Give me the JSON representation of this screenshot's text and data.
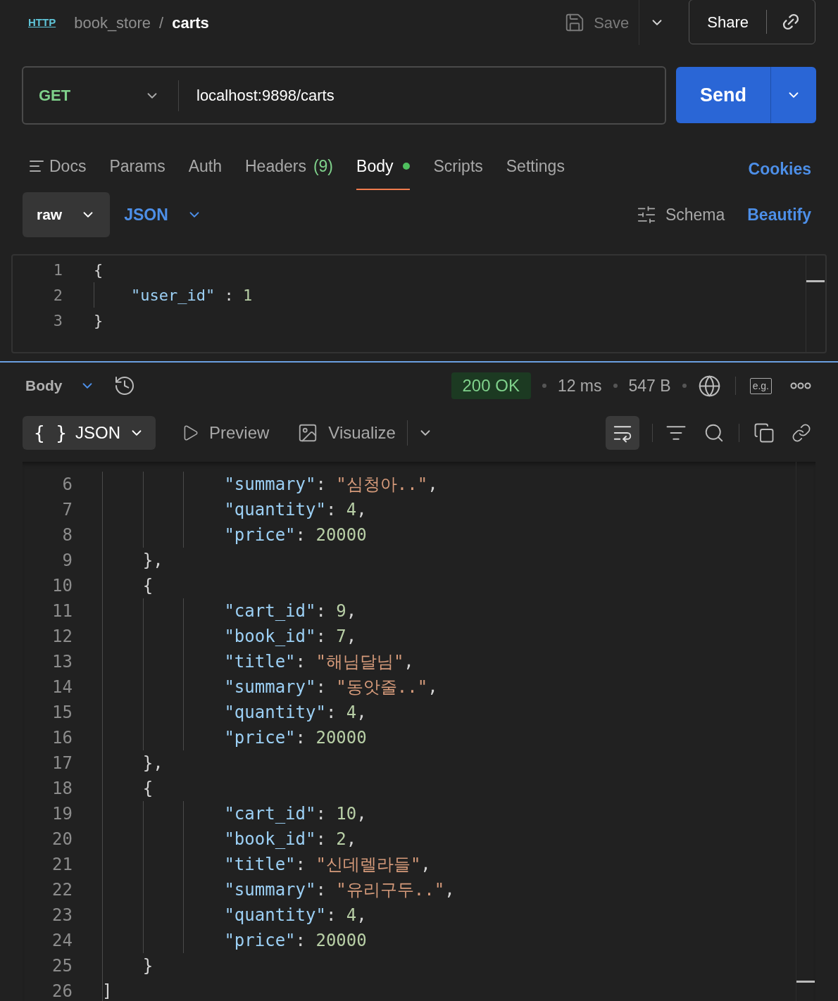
{
  "breadcrumb": {
    "icon_text": "HTTP",
    "collection": "book_store",
    "separator": "/",
    "request": "carts"
  },
  "toolbar": {
    "save": "Save",
    "share": "Share"
  },
  "request": {
    "method": "GET",
    "url": "localhost:9898/carts",
    "send": "Send"
  },
  "tabs": [
    {
      "kind": "docs",
      "label": "Docs",
      "selected": false,
      "has_content": false
    },
    {
      "kind": "plain",
      "label": "Params",
      "selected": false,
      "has_content": false
    },
    {
      "kind": "plain",
      "label": "Auth",
      "selected": false,
      "has_content": false
    },
    {
      "kind": "plain",
      "label": "Headers",
      "count": "(9)",
      "selected": false,
      "has_content": false
    },
    {
      "kind": "plain",
      "label": "Body",
      "selected": true,
      "has_content": true
    },
    {
      "kind": "plain",
      "label": "Scripts",
      "selected": false,
      "has_content": false
    },
    {
      "kind": "plain",
      "label": "Settings",
      "selected": false,
      "has_content": false
    }
  ],
  "cookies": "Cookies",
  "body_options": {
    "mode": "raw",
    "language": "JSON",
    "schema": "Schema",
    "beautify": "Beautify"
  },
  "request_body": [
    {
      "n": "1",
      "tokens": [
        {
          "kind": "punct",
          "text": "{"
        }
      ]
    },
    {
      "n": "2",
      "tokens": [
        {
          "kind": "key",
          "text": "    \"user_id\""
        },
        {
          "kind": "punct",
          "text": " : "
        },
        {
          "kind": "number",
          "text": "1"
        }
      ]
    },
    {
      "n": "3",
      "tokens": [
        {
          "kind": "punct",
          "text": "}"
        }
      ]
    }
  ],
  "response": {
    "view": "Body",
    "status": "200 OK",
    "time": "12 ms",
    "size": "547 B",
    "examples": "e.g.",
    "format_glyph": "{ }",
    "format": "JSON",
    "preview": "Preview",
    "visualize": "Visualize",
    "wrap_on": true,
    "lines": [
      {
        "n": "6",
        "tokens": [
          {
            "kind": "key",
            "text": "            \"summary\""
          },
          {
            "kind": "punct",
            "text": ": "
          },
          {
            "kind": "string",
            "text": "\"심청아..\""
          },
          {
            "kind": "punct",
            "text": ","
          }
        ]
      },
      {
        "n": "7",
        "tokens": [
          {
            "kind": "key",
            "text": "            \"quantity\""
          },
          {
            "kind": "punct",
            "text": ": "
          },
          {
            "kind": "number",
            "text": "4"
          },
          {
            "kind": "punct",
            "text": ","
          }
        ]
      },
      {
        "n": "8",
        "tokens": [
          {
            "kind": "key",
            "text": "            \"price\""
          },
          {
            "kind": "punct",
            "text": ": "
          },
          {
            "kind": "number",
            "text": "20000"
          }
        ]
      },
      {
        "n": "9",
        "tokens": [
          {
            "kind": "punct",
            "text": "    },"
          }
        ]
      },
      {
        "n": "10",
        "tokens": [
          {
            "kind": "punct",
            "text": "    {"
          }
        ]
      },
      {
        "n": "11",
        "tokens": [
          {
            "kind": "key",
            "text": "            \"cart_id\""
          },
          {
            "kind": "punct",
            "text": ": "
          },
          {
            "kind": "number",
            "text": "9"
          },
          {
            "kind": "punct",
            "text": ","
          }
        ]
      },
      {
        "n": "12",
        "tokens": [
          {
            "kind": "key",
            "text": "            \"book_id\""
          },
          {
            "kind": "punct",
            "text": ": "
          },
          {
            "kind": "number",
            "text": "7"
          },
          {
            "kind": "punct",
            "text": ","
          }
        ]
      },
      {
        "n": "13",
        "tokens": [
          {
            "kind": "key",
            "text": "            \"title\""
          },
          {
            "kind": "punct",
            "text": ": "
          },
          {
            "kind": "string",
            "text": "\"해님달님\""
          },
          {
            "kind": "punct",
            "text": ","
          }
        ]
      },
      {
        "n": "14",
        "tokens": [
          {
            "kind": "key",
            "text": "            \"summary\""
          },
          {
            "kind": "punct",
            "text": ": "
          },
          {
            "kind": "string",
            "text": "\"동앗줄..\""
          },
          {
            "kind": "punct",
            "text": ","
          }
        ]
      },
      {
        "n": "15",
        "tokens": [
          {
            "kind": "key",
            "text": "            \"quantity\""
          },
          {
            "kind": "punct",
            "text": ": "
          },
          {
            "kind": "number",
            "text": "4"
          },
          {
            "kind": "punct",
            "text": ","
          }
        ]
      },
      {
        "n": "16",
        "tokens": [
          {
            "kind": "key",
            "text": "            \"price\""
          },
          {
            "kind": "punct",
            "text": ": "
          },
          {
            "kind": "number",
            "text": "20000"
          }
        ]
      },
      {
        "n": "17",
        "tokens": [
          {
            "kind": "punct",
            "text": "    },"
          }
        ]
      },
      {
        "n": "18",
        "tokens": [
          {
            "kind": "punct",
            "text": "    {"
          }
        ]
      },
      {
        "n": "19",
        "tokens": [
          {
            "kind": "key",
            "text": "            \"cart_id\""
          },
          {
            "kind": "punct",
            "text": ": "
          },
          {
            "kind": "number",
            "text": "10"
          },
          {
            "kind": "punct",
            "text": ","
          }
        ]
      },
      {
        "n": "20",
        "tokens": [
          {
            "kind": "key",
            "text": "            \"book_id\""
          },
          {
            "kind": "punct",
            "text": ": "
          },
          {
            "kind": "number",
            "text": "2"
          },
          {
            "kind": "punct",
            "text": ","
          }
        ]
      },
      {
        "n": "21",
        "tokens": [
          {
            "kind": "key",
            "text": "            \"title\""
          },
          {
            "kind": "punct",
            "text": ": "
          },
          {
            "kind": "string",
            "text": "\"신데렐라들\""
          },
          {
            "kind": "punct",
            "text": ","
          }
        ]
      },
      {
        "n": "22",
        "tokens": [
          {
            "kind": "key",
            "text": "            \"summary\""
          },
          {
            "kind": "punct",
            "text": ": "
          },
          {
            "kind": "string",
            "text": "\"유리구두..\""
          },
          {
            "kind": "punct",
            "text": ","
          }
        ]
      },
      {
        "n": "23",
        "tokens": [
          {
            "kind": "key",
            "text": "            \"quantity\""
          },
          {
            "kind": "punct",
            "text": ": "
          },
          {
            "kind": "number",
            "text": "4"
          },
          {
            "kind": "punct",
            "text": ","
          }
        ]
      },
      {
        "n": "24",
        "tokens": [
          {
            "kind": "key",
            "text": "            \"price\""
          },
          {
            "kind": "punct",
            "text": ": "
          },
          {
            "kind": "number",
            "text": "20000"
          }
        ]
      },
      {
        "n": "25",
        "tokens": [
          {
            "kind": "punct",
            "text": "    }"
          }
        ]
      },
      {
        "n": "26",
        "tokens": [
          {
            "kind": "punct",
            "text": "]"
          }
        ]
      }
    ]
  }
}
